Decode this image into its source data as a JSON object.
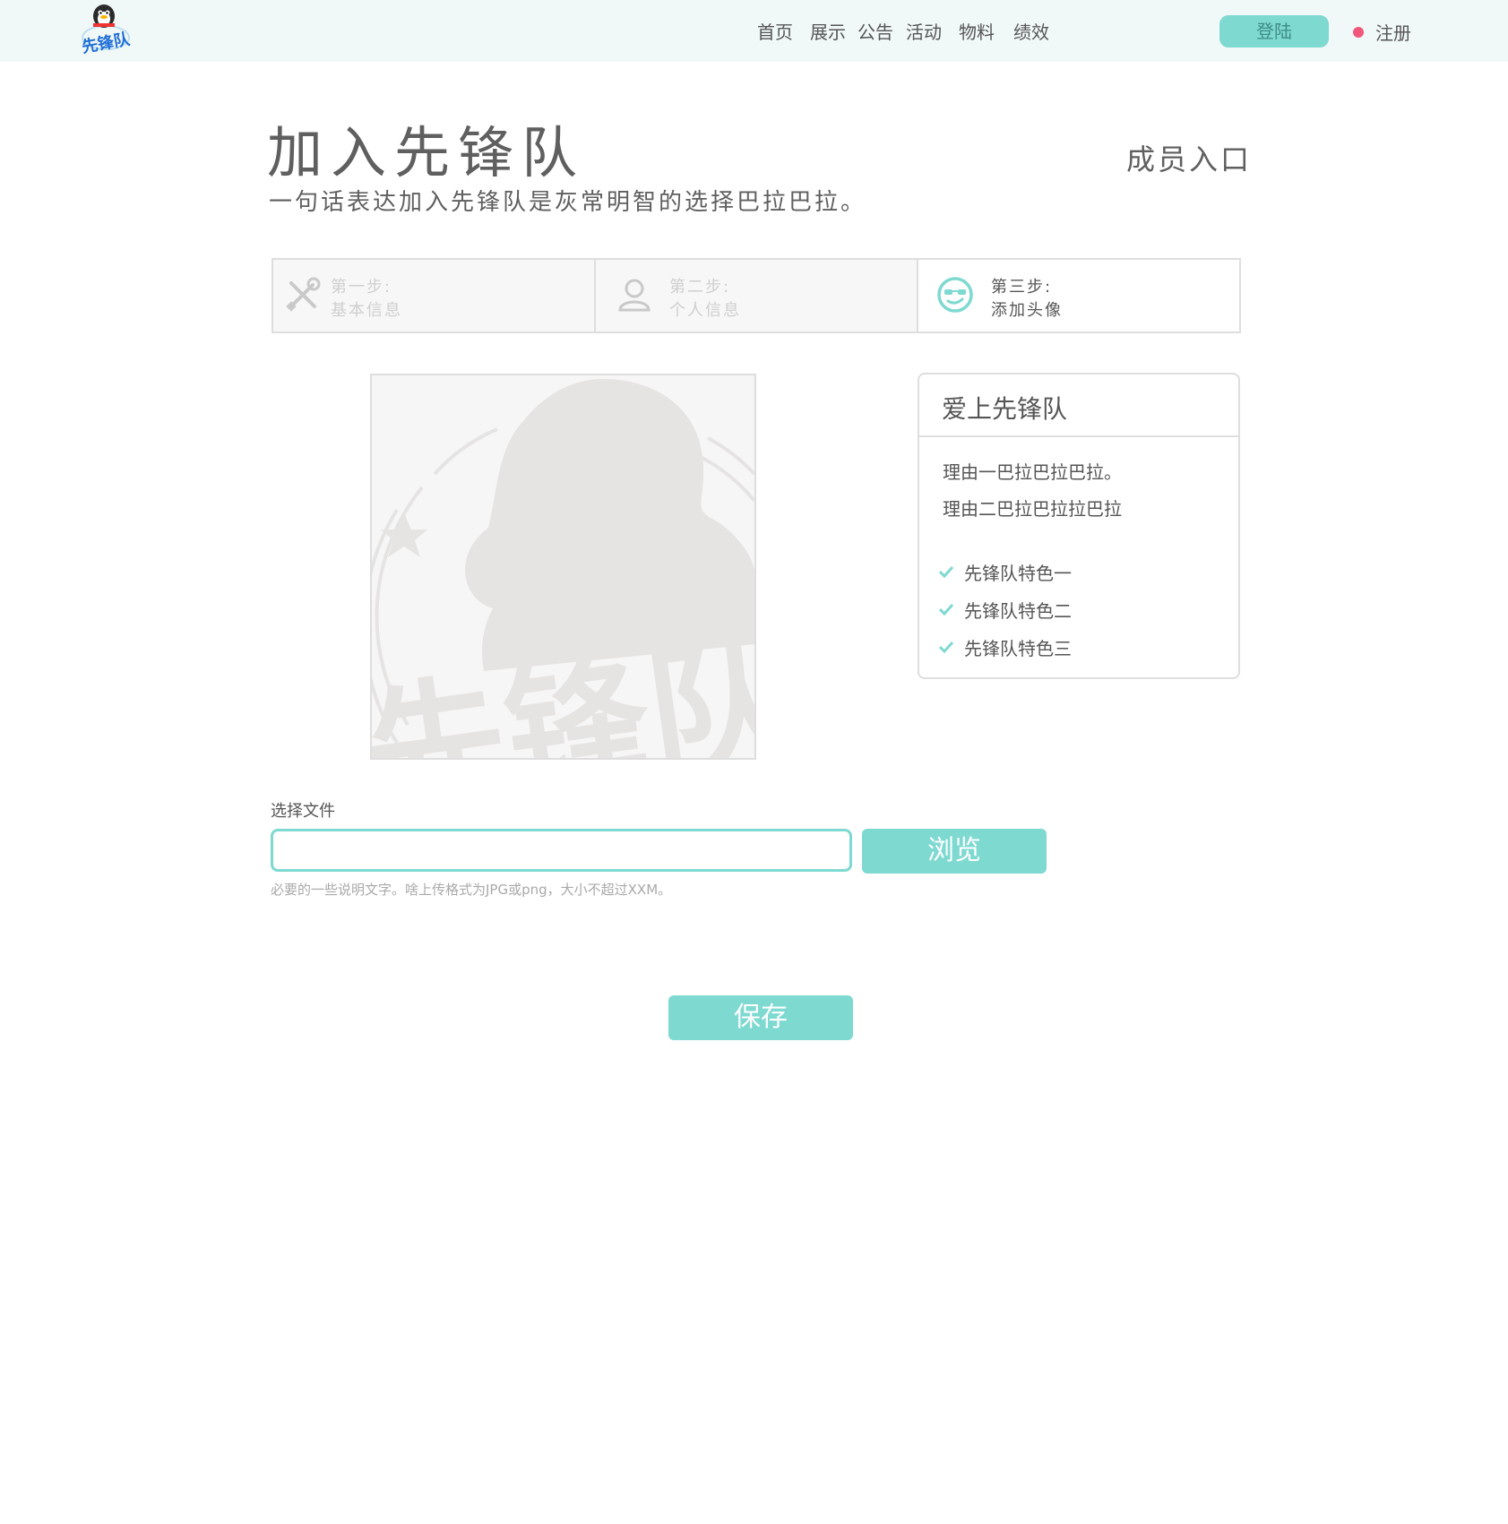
{
  "logo": {
    "text": "先锋队"
  },
  "nav": {
    "items": [
      "首页",
      "展示",
      "公告",
      "活动",
      "物料",
      "绩效"
    ]
  },
  "auth": {
    "login_label": "登陆",
    "register_label": "注册"
  },
  "header": {
    "title": "加入先锋队",
    "subtitle": "一句话表达加入先锋队是灰常明智的选择巴拉巴拉。",
    "member_entry": "成员入口"
  },
  "steps": [
    {
      "label": "第一步:",
      "desc": "基本信息",
      "icon": "tools-icon",
      "state": "inactive"
    },
    {
      "label": "第二步:",
      "desc": "个人信息",
      "icon": "user-icon",
      "state": "inactive"
    },
    {
      "label": "第三步:",
      "desc": "添加头像",
      "icon": "smiley-sunglasses-icon",
      "state": "active"
    }
  ],
  "avatar": {
    "placeholder_text": "先锋队"
  },
  "panel": {
    "title": "爱上先锋队",
    "reasons": [
      "理由一巴拉巴拉巴拉。",
      "理由二巴拉巴拉拉巴拉"
    ],
    "features": [
      "先锋队特色一",
      "先锋队特色二",
      "先锋队特色三"
    ]
  },
  "upload": {
    "label": "选择文件",
    "value": "",
    "browse_label": "浏览",
    "hint": "必要的一些说明文字。啥上传格式为JPG或png，大小不超过XXM。"
  },
  "save_label": "保存",
  "colors": {
    "accent": "#7ed9d1",
    "topbar_bg": "#f1f8f8",
    "register_dot": "#f0577b",
    "text": "#555555",
    "muted": "#cfcfcf",
    "border": "#dedede"
  }
}
